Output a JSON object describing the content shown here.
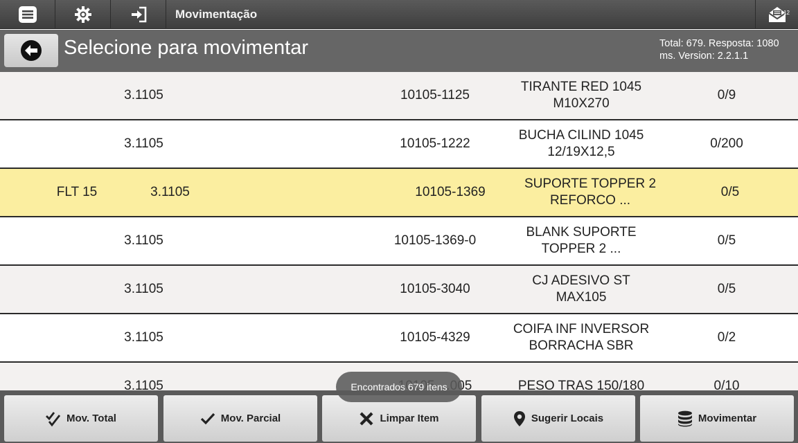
{
  "topbar": {
    "title": "Movimentação",
    "menu_icon": "menu-list-icon",
    "settings_icon": "gear-icon",
    "login_icon": "sign-in-icon",
    "mail_icon": "mail-open-icon",
    "mail_count": "12"
  },
  "header": {
    "title": "Selecione para movimentar",
    "info": "Total: 679. Resposta: 1080 ms. Version: 2.2.1.1",
    "back_icon": "arrow-left-circle-icon"
  },
  "rows": [
    {
      "local": "",
      "code": "3.1105",
      "ref": "10105-1125",
      "desc": "TIRANTE RED 1045 M10X270",
      "qty": "0/9"
    },
    {
      "local": "",
      "code": "3.1105",
      "ref": "10105-1222",
      "desc": "BUCHA CILIND 1045 12/19X12,5",
      "qty": "0/200"
    },
    {
      "local": "FLT 15",
      "code": "3.1105",
      "ref": "10105-1369",
      "desc": "SUPORTE TOPPER 2 REFORCO ...",
      "qty": "0/5"
    },
    {
      "local": "",
      "code": "3.1105",
      "ref": "10105-1369-0",
      "desc": "BLANK SUPORTE TOPPER 2 ...",
      "qty": "0/5"
    },
    {
      "local": "",
      "code": "3.1105",
      "ref": "10105-3040",
      "desc": "CJ ADESIVO ST MAX105",
      "qty": "0/5"
    },
    {
      "local": "",
      "code": "3.1105",
      "ref": "10105-4329",
      "desc": "COIFA INF INVERSOR BORRACHA SBR",
      "qty": "0/2"
    },
    {
      "local": "",
      "code": "3.1105",
      "ref": "10105-...005",
      "desc": "PESO TRAS 150/180",
      "qty": "0/10"
    }
  ],
  "toast": "Encontrados 679 itens",
  "buttons": [
    {
      "label": "Mov. Total",
      "icon": "double-check-icon"
    },
    {
      "label": "Mov. Parcial",
      "icon": "check-icon"
    },
    {
      "label": "Limpar Item",
      "icon": "x-icon"
    },
    {
      "label": "Sugerir Locais",
      "icon": "map-pin-icon"
    },
    {
      "label": "Movimentar",
      "icon": "database-icon"
    }
  ],
  "colors": {
    "topbar": "#4a4a4a",
    "header": "#666666",
    "row_highlight": "#fbeea0",
    "row_alt": "#f3f1f0"
  }
}
